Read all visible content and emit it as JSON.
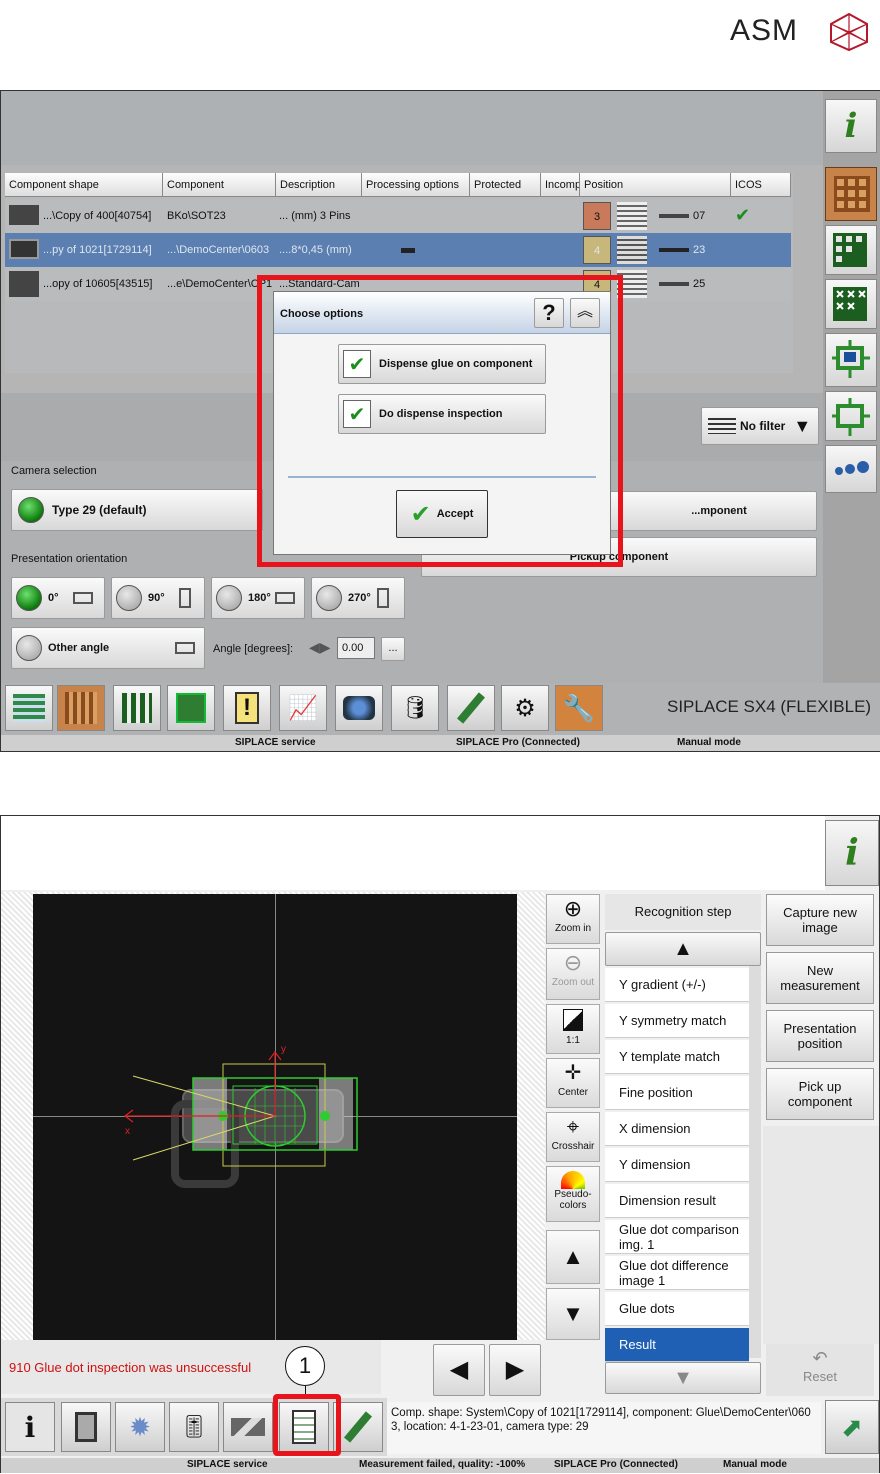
{
  "brand": {
    "name": "ASM"
  },
  "screen1": {
    "table": {
      "headers": [
        "Component shape",
        "Component",
        "Description",
        "Processing options",
        "Protected",
        "Incomp",
        "Position",
        "ICOS"
      ],
      "rows": [
        {
          "shape": "...\\Copy of 400[40754]",
          "component": "BKo\\SOT23",
          "description": "... (mm)  3 Pins",
          "position": "3",
          "pos_value": "07",
          "icos": true
        },
        {
          "shape": "...py of 1021[1729114]",
          "component": "...\\DemoCenter\\0603",
          "description": "....8*0,45 (mm)",
          "position": "4",
          "pos_value": "23",
          "icos": false
        },
        {
          "shape": "...opy of 10605[43515]",
          "component": "...e\\DemoCenter\\CP1",
          "description": "...Standard-Cam",
          "position": "4",
          "pos_value": "25",
          "icos": false
        }
      ]
    },
    "filter_label": "No filter",
    "camera_selection": {
      "title": "Camera selection",
      "selected": "Type 29 (default)"
    },
    "presentation": {
      "title": "Presentation orientation",
      "options": [
        "0°",
        "90°",
        "180°",
        "270°"
      ],
      "other_angle": "Other angle",
      "angle_label": "Angle [degrees]:",
      "angle_value": "0.00",
      "ellipsis": "..."
    },
    "right_buttons": [
      "...mponent",
      "Pickup component"
    ],
    "dialog": {
      "title": "Choose options",
      "help": "?",
      "options": [
        {
          "label": "Dispense glue on component",
          "checked": true
        },
        {
          "label": "Do dispense inspection",
          "checked": true
        }
      ],
      "accept": "Accept"
    },
    "machine_name": "SIPLACE SX4 (FLEXIBLE)",
    "status": [
      "SIPLACE service",
      "SIPLACE Pro (Connected)",
      "Manual mode"
    ]
  },
  "screen2": {
    "tools": [
      {
        "label": "Zoom in",
        "icon": "zoom-in-icon"
      },
      {
        "label": "Zoom out",
        "icon": "zoom-out-icon"
      },
      {
        "label": "1:1",
        "icon": "one-to-one-icon"
      },
      {
        "label": "Center",
        "icon": "center-icon"
      },
      {
        "label": "Crosshair",
        "icon": "crosshair-icon"
      },
      {
        "label": "Pseudo-colors",
        "icon": "rainbow-icon"
      }
    ],
    "recognition": {
      "title": "Recognition step",
      "steps": [
        "Y gradient (+/-)",
        "Y symmetry match",
        "Y template match",
        "Fine position",
        "X dimension",
        "Y dimension",
        "Dimension result",
        "Glue dot comparison img. 1",
        "Glue dot difference image 1",
        "Glue dots",
        "Result"
      ],
      "selected": "Result"
    },
    "actions": [
      "Capture new image",
      "New measurement",
      "Presentation position",
      "Pick up component"
    ],
    "reset": "Reset",
    "error": "910  Glue dot inspection was unsuccessful",
    "callout": "1",
    "info": "Comp. shape: System\\Copy of 1021[1729114], component: Glue\\DemoCenter\\0603, location: 4-1-23-01, camera type: 29",
    "axis_x": "x",
    "axis_y": "y",
    "status": [
      "SIPLACE service",
      "Measurement failed, quality: -100%",
      "SIPLACE Pro (Connected)",
      "Manual mode"
    ]
  },
  "colors": {
    "highlight_red": "#e8141b",
    "selection_blue": "#1f5fb4",
    "orange": "#c87a3a"
  }
}
